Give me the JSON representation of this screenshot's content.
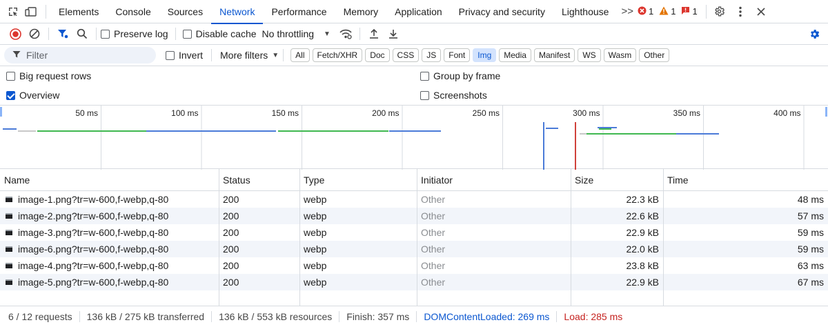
{
  "tabs": [
    {
      "label": "Elements"
    },
    {
      "label": "Console"
    },
    {
      "label": "Sources"
    },
    {
      "label": "Network",
      "active": true
    },
    {
      "label": "Performance"
    },
    {
      "label": "Memory"
    },
    {
      "label": "Application"
    },
    {
      "label": "Privacy and security"
    },
    {
      "label": "Lighthouse"
    }
  ],
  "tabbar": {
    "more_label": ">>",
    "errors": "1",
    "warnings": "1",
    "issues": "1"
  },
  "toolbar": {
    "preserve_log": "Preserve log",
    "disable_cache": "Disable cache",
    "throttling": "No throttling"
  },
  "filterbar": {
    "placeholder": "Filter",
    "invert": "Invert",
    "more_filters": "More filters",
    "chips": [
      {
        "label": "All"
      },
      {
        "label": "Fetch/XHR"
      },
      {
        "label": "Doc"
      },
      {
        "label": "CSS"
      },
      {
        "label": "JS"
      },
      {
        "label": "Font"
      },
      {
        "label": "Img",
        "active": true
      },
      {
        "label": "Media"
      },
      {
        "label": "Manifest"
      },
      {
        "label": "WS"
      },
      {
        "label": "Wasm"
      },
      {
        "label": "Other"
      }
    ]
  },
  "options": {
    "big_rows": "Big request rows",
    "overview": "Overview",
    "group_by_frame": "Group by frame",
    "screenshots": "Screenshots"
  },
  "overview": {
    "ticks": [
      "50 ms",
      "100 ms",
      "150 ms",
      "200 ms",
      "250 ms",
      "300 ms",
      "350 ms",
      "400 ms"
    ],
    "dom_content_loaded_ms": 269,
    "load_ms": 285,
    "colors": {
      "dcl": "#4b7bd8",
      "load": "#d0413a",
      "download": "#4b7bd8",
      "wait": "#3fb850"
    }
  },
  "table": {
    "headers": [
      "Name",
      "Status",
      "Type",
      "Initiator",
      "Size",
      "Time"
    ],
    "rows": [
      {
        "name": "image-1.png?tr=w-600,f-webp,q-80",
        "status": "200",
        "type": "webp",
        "initiator": "Other",
        "size": "22.3 kB",
        "time": "48 ms"
      },
      {
        "name": "image-2.png?tr=w-600,f-webp,q-80",
        "status": "200",
        "type": "webp",
        "initiator": "Other",
        "size": "22.6 kB",
        "time": "57 ms"
      },
      {
        "name": "image-3.png?tr=w-600,f-webp,q-80",
        "status": "200",
        "type": "webp",
        "initiator": "Other",
        "size": "22.9 kB",
        "time": "59 ms"
      },
      {
        "name": "image-6.png?tr=w-600,f-webp,q-80",
        "status": "200",
        "type": "webp",
        "initiator": "Other",
        "size": "22.0 kB",
        "time": "59 ms"
      },
      {
        "name": "image-4.png?tr=w-600,f-webp,q-80",
        "status": "200",
        "type": "webp",
        "initiator": "Other",
        "size": "23.8 kB",
        "time": "63 ms"
      },
      {
        "name": "image-5.png?tr=w-600,f-webp,q-80",
        "status": "200",
        "type": "webp",
        "initiator": "Other",
        "size": "22.9 kB",
        "time": "67 ms"
      }
    ]
  },
  "status": {
    "requests": "6 / 12 requests",
    "transferred": "136 kB / 275 kB transferred",
    "resources": "136 kB / 553 kB resources",
    "finish": "Finish: 357 ms",
    "dcl": "DOMContentLoaded: 269 ms",
    "load": "Load: 285 ms"
  }
}
